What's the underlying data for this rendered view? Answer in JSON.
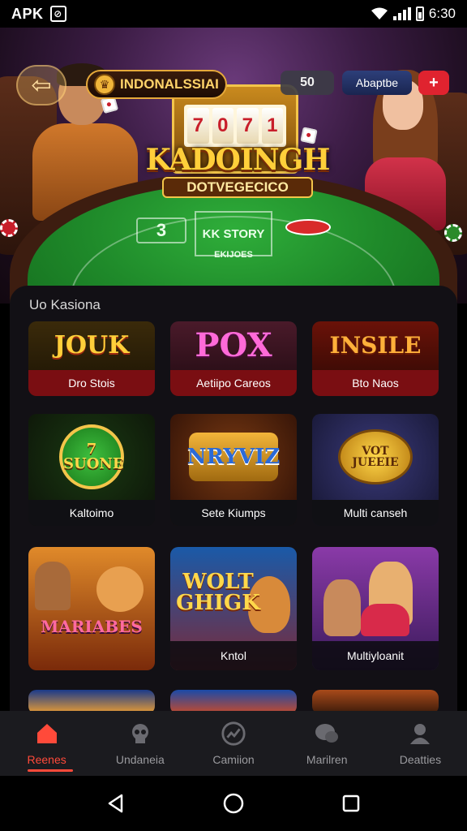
{
  "status_bar": {
    "carrier": "APK",
    "time": "6:30"
  },
  "header": {
    "brand": "INDONALSSIAI",
    "balance": "50",
    "action_button": "Abaptbe",
    "gift_button": "+"
  },
  "hero": {
    "title": "KADOINGH",
    "subtitle": "DOTVEGECICO",
    "reels": [
      "7",
      "0",
      "7",
      "1"
    ],
    "felt_left": "3",
    "felt_center": "KK STORY",
    "felt_bottom": "EKIJOES"
  },
  "games": {
    "heading": "Uo Kasiona",
    "items": [
      {
        "label": "Dro Stois",
        "art": "JOUK",
        "art_color": "#ffcf3a"
      },
      {
        "label": "Aetiipo Careos",
        "art": "POX",
        "art_color": "#ff5ad2"
      },
      {
        "label": "Bto Naos",
        "art": "INSILE",
        "art_color": "#ffb03a"
      },
      {
        "label": "Kaltoimo",
        "art": "7 SUONE",
        "art_color": "#ffd84a"
      },
      {
        "label": "Sete Kiumps",
        "art": "NRYVIZ",
        "art_color": "#4ab8ff"
      },
      {
        "label": "Multi canseh",
        "art": "VOT JUEEIE",
        "art_color": "#ffd84a"
      },
      {
        "label": "",
        "art": "MARIABES",
        "art_color": "#ff6a3a"
      },
      {
        "label": "Kntol",
        "art": "WOLT GHIGK",
        "art_color": "#ffd84a"
      },
      {
        "label": "Multiyloanit",
        "art": "",
        "art_color": "#ff7ad8"
      }
    ]
  },
  "bottom_nav": {
    "items": [
      {
        "label": "Reenes",
        "icon": "home-icon"
      },
      {
        "label": "Undaneia",
        "icon": "skull-icon"
      },
      {
        "label": "Camiion",
        "icon": "chart-icon"
      },
      {
        "label": "Marilren",
        "icon": "chat-icon"
      },
      {
        "label": "Deatties",
        "icon": "person-icon"
      }
    ]
  },
  "colors": {
    "accent": "#ff4a3a",
    "panel": "#121015",
    "nav_bg": "#1b1b1f"
  }
}
